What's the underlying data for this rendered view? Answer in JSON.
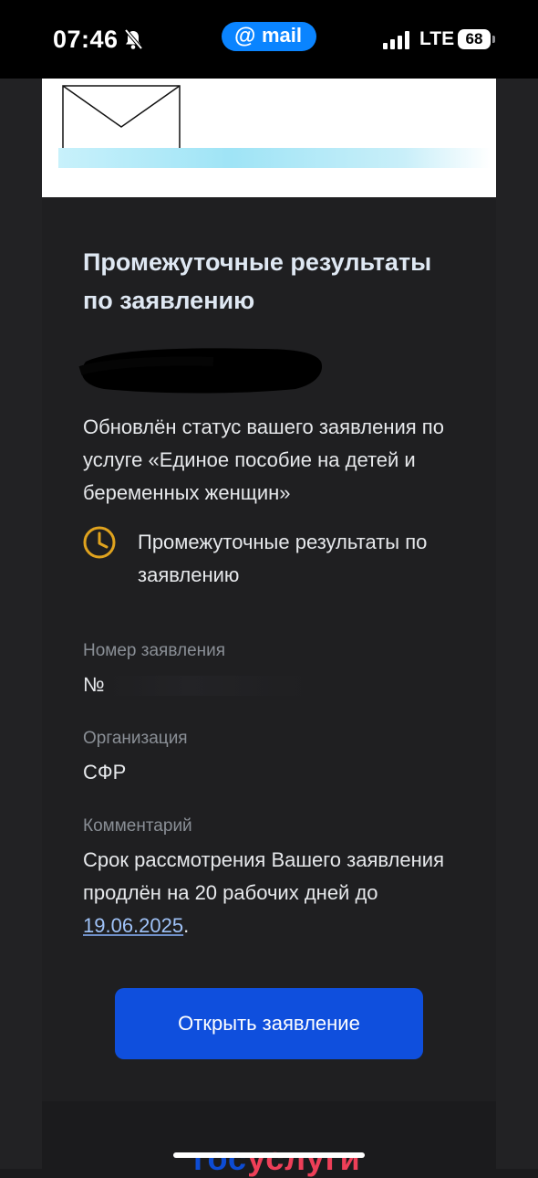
{
  "status_bar": {
    "time": "07:46",
    "mail_pill": {
      "at": "@",
      "label": "mail"
    },
    "network": "LTE",
    "battery": "68"
  },
  "email": {
    "title": "Промежуточные результаты по заявлению",
    "intro": "Обновлён статус вашего заявления по услуге «Единое пособие на детей и беременных женщин»",
    "status": {
      "icon": "clock-icon",
      "text": "Промежуточные результаты по заявлению"
    },
    "fields": {
      "application_number_label": "Номер заявления",
      "application_number_prefix": "№",
      "organization_label": "Организация",
      "organization_value": "СФР",
      "comment_label": "Комментарий",
      "comment_text": "Срок рассмотрения Вашего заявления продлён на 20 рабочих дней до ",
      "comment_date": "19.06.2025",
      "comment_tail": "."
    },
    "open_button_label": "Открыть заявление"
  },
  "footer": {
    "logo_part1": "гос",
    "logo_part2": "услуги"
  },
  "colors": {
    "background": "#1b1b1d",
    "card": "#1f1f21",
    "accent_button": "#0f4fdd",
    "status_icon": "#e0a31e",
    "mail_pill": "#0a84ff"
  }
}
